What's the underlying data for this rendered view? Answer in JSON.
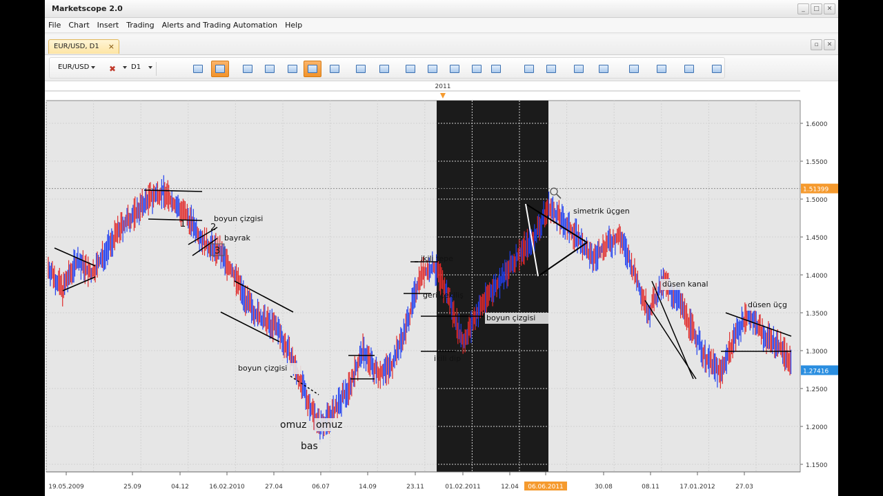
{
  "app": {
    "title": "Marketscope 2.0"
  },
  "window_controls": {
    "minimize": "_",
    "maximize": "□",
    "close": "✕"
  },
  "menu": [
    "File",
    "Chart",
    "Insert",
    "Trading",
    "Alerts and Trading Automation",
    "Help"
  ],
  "tab": {
    "label": "EUR/USD, D1",
    "close": "×"
  },
  "toolbar": {
    "instrument": "EUR/USD",
    "timeframe": "D1",
    "icons": [
      "chart-type-icon",
      "bar-chart-icon",
      "candle-chart-icon",
      "indicators-icon",
      "signals-icon",
      "cursor-icon",
      "zoom-icon",
      "scroll-end-icon",
      "snap-icon",
      "refresh-icon",
      "globe-icon",
      "ruler-icon",
      "image-icon",
      "template-icon",
      "crosshair-icon",
      "lines-icon",
      "fib-icon",
      "pen-icon",
      "ellipse-icon",
      "text-icon",
      "eraser-icon",
      "tree-icon"
    ]
  },
  "colors": {
    "accent": "#f59a2e",
    "up": "#1f3ff0",
    "down": "#e02a2a",
    "shade": "#1b1b1b"
  },
  "chart": {
    "year_marker": "2011",
    "y_ticks": [
      "1.6000",
      "1.5500",
      "1.5000",
      "1.4500",
      "1.4000",
      "1.3500",
      "1.3000",
      "1.2500",
      "1.2000",
      "1.1500"
    ],
    "x_ticks": [
      "19.05.2009",
      "25.09",
      "04.12",
      "16.02.2010",
      "27.04",
      "06.07",
      "14.09",
      "23.11",
      "01.02.2011",
      "12.04",
      "06.06.2011",
      "30.08",
      "08.11",
      "17.01.2012",
      "27.03"
    ],
    "highlighted_x": "06.06.2011",
    "price_labels": [
      "1.51399",
      "1.27416"
    ],
    "annotations": [
      "boyun çizgisi",
      "bayrak",
      "1",
      "2",
      "3",
      "boyun çizgisi",
      "omuz",
      "omuz",
      "bas",
      "ikili tepe",
      "geri çekiliş",
      "boyun çizgisi",
      "ikili dip",
      "simetrik üçgen",
      "düsen kanal",
      "düsen üçg"
    ]
  },
  "chart_data": {
    "type": "line",
    "series": [
      {
        "values": [
          1.41,
          1.38,
          1.42,
          1.4,
          1.43,
          1.46,
          1.48,
          1.5,
          1.51,
          1.49,
          1.47,
          1.44,
          1.43,
          1.4,
          1.36,
          1.34,
          1.33,
          1.29,
          1.24,
          1.2,
          1.22,
          1.25,
          1.3,
          1.27,
          1.28,
          1.33,
          1.4,
          1.41,
          1.37,
          1.31,
          1.35,
          1.38,
          1.4,
          1.43,
          1.45,
          1.49,
          1.47,
          1.45,
          1.42,
          1.44,
          1.45,
          1.4,
          1.35,
          1.39,
          1.37,
          1.33,
          1.29,
          1.27,
          1.32,
          1.35,
          1.32,
          1.31,
          1.28
        ]
      }
    ],
    "ylim": [
      1.14,
      1.63
    ]
  }
}
